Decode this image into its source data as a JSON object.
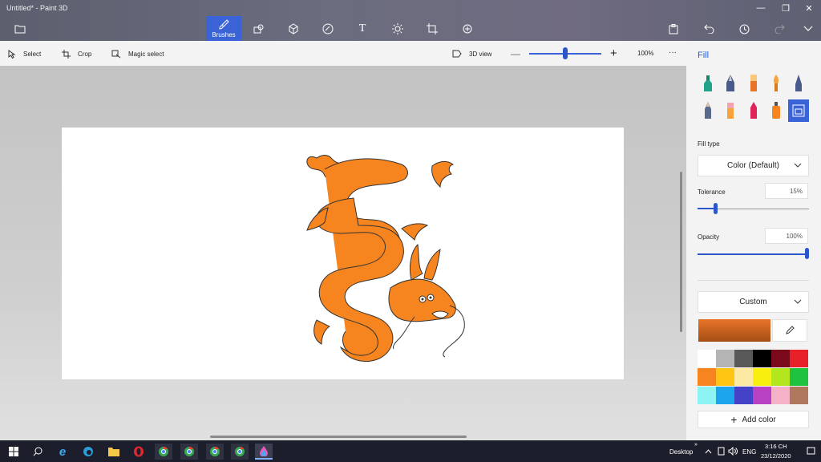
{
  "window": {
    "title": "Untitled* - Paint 3D"
  },
  "toolbar": {
    "brushes_label": "Brushes"
  },
  "subtoolbar": {
    "select_label": "Select",
    "crop_label": "Crop",
    "magic_select_label": "Magic select",
    "view3d_label": "3D view",
    "zoom_level": "100%",
    "more": "···"
  },
  "panel": {
    "title": "Fill",
    "fill_type_label": "Fill type",
    "fill_type_value": "Color (Default)",
    "tolerance_label": "Tolerance",
    "tolerance_value": "15%",
    "opacity_label": "Opacity",
    "opacity_value": "100%",
    "color_mode": "Custom",
    "add_color_label": "Add color",
    "current_color": "#e8742a",
    "palette": [
      "#ffffff",
      "#b4b4b4",
      "#595959",
      "#000000",
      "#7a0a1b",
      "#e8202a",
      "#f7851f",
      "#ffc512",
      "#fde8a4",
      "#f8ef0e",
      "#b3e61c",
      "#1ec23e",
      "#8ef3f3",
      "#1ca5ed",
      "#4642c8",
      "#b740c3",
      "#f5b2c6",
      "#b0785c"
    ]
  },
  "taskbar": {
    "desktop_label": "Desktop",
    "language": "ENG",
    "time": "3:16 CH",
    "date": "23/12/2020"
  },
  "colors": {
    "accent": "#3b63d8",
    "dragon_fill": "#f7851f"
  }
}
